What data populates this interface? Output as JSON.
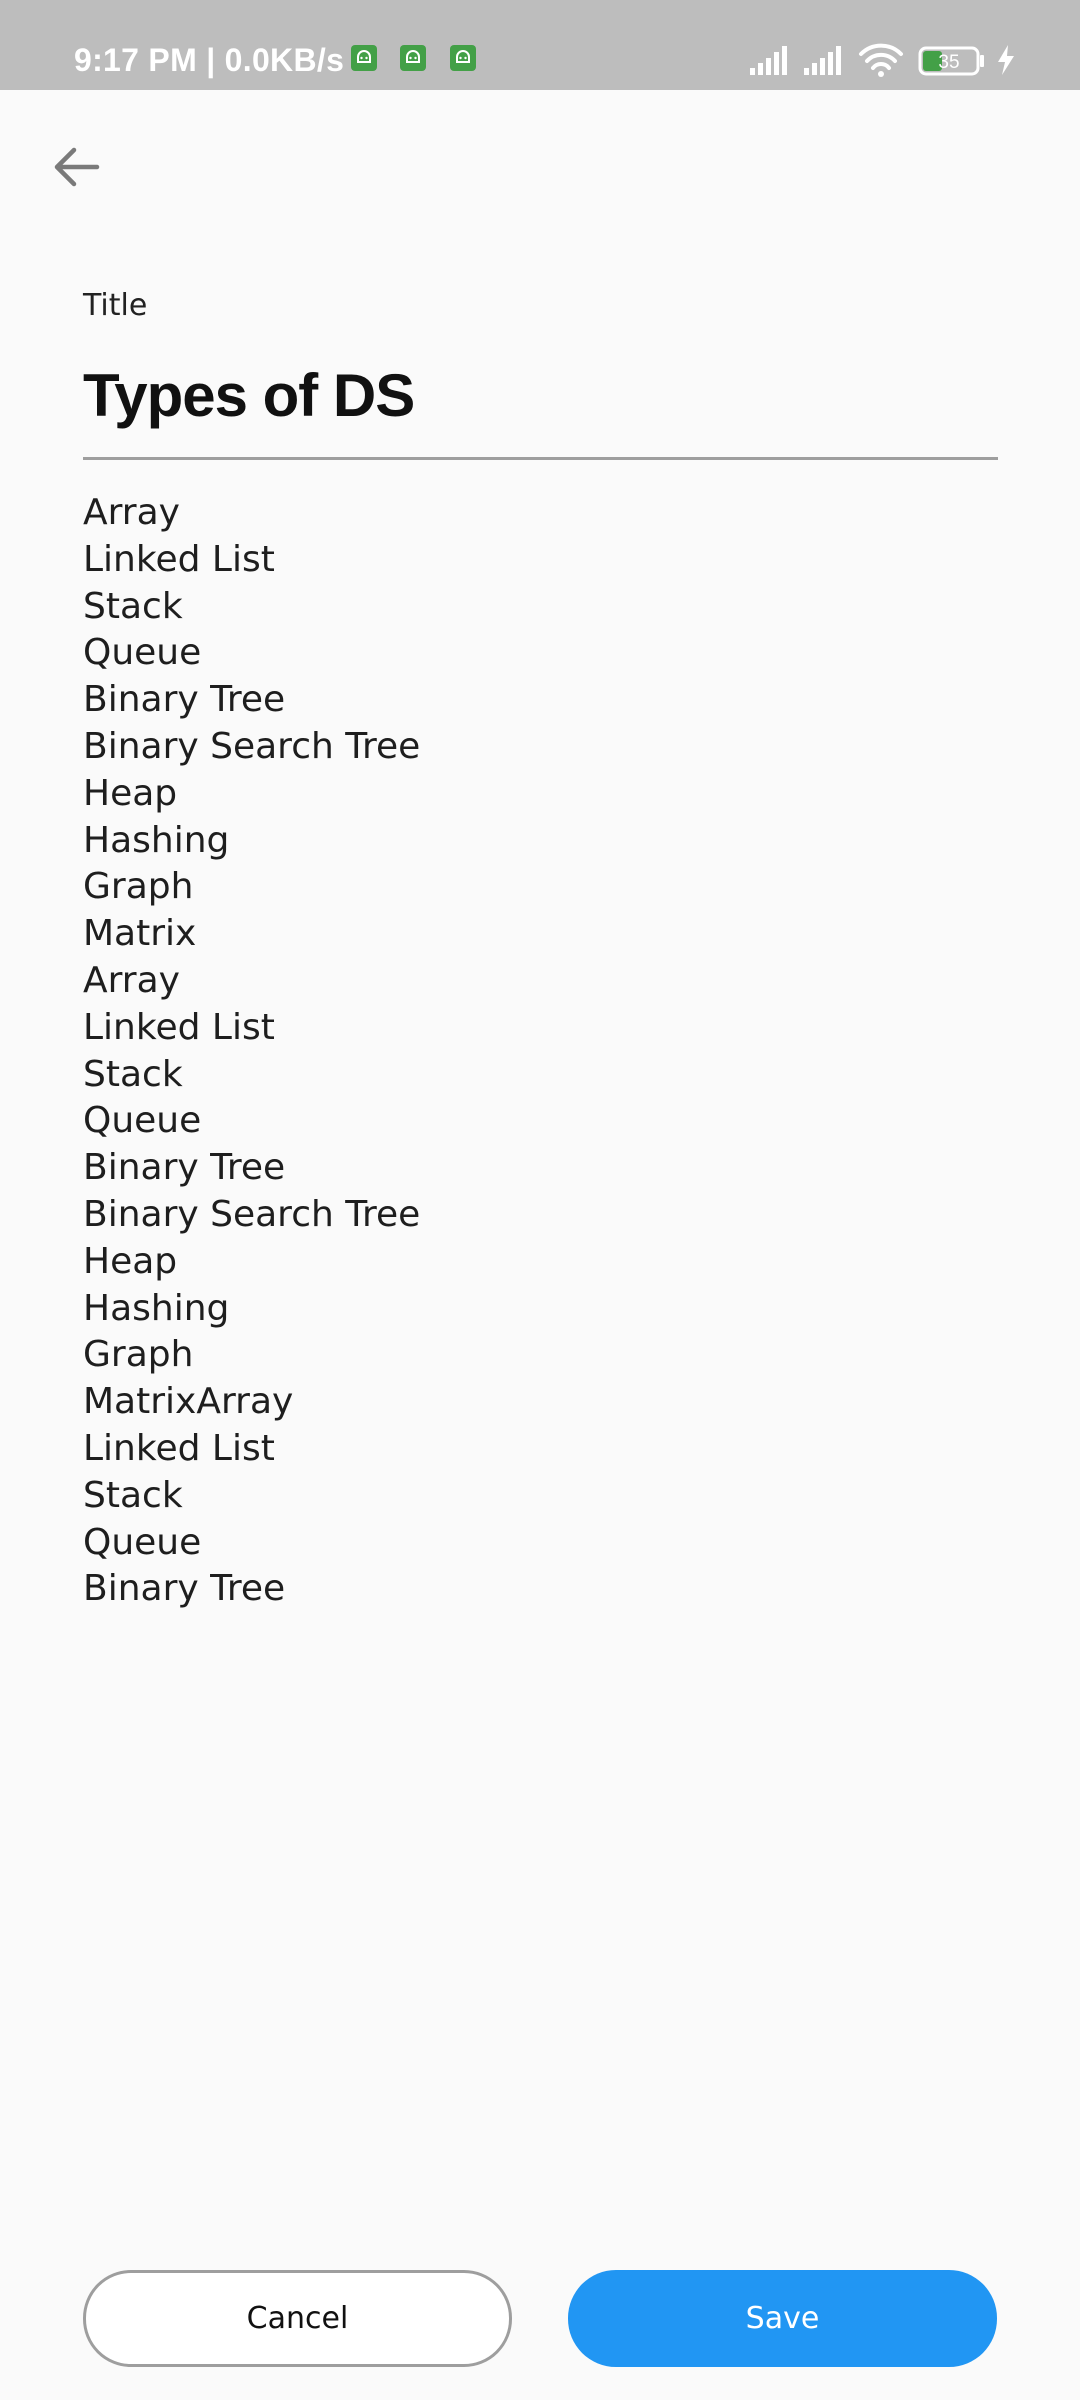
{
  "status_bar": {
    "time_text": "9:17 PM | 0.0KB/s",
    "battery_level": "35",
    "notification_icons": [
      "android-icon",
      "android-icon",
      "android-icon"
    ]
  },
  "header": {
    "back_icon": "arrow-left-icon"
  },
  "form": {
    "title_label": "Title",
    "title_value": "Types of DS",
    "body_lines": [
      "Array",
      "Linked List",
      "Stack",
      "Queue",
      "Binary Tree",
      "Binary Search Tree",
      "Heap",
      "Hashing",
      "Graph",
      "Matrix",
      "Array",
      "Linked List",
      "Stack",
      "Queue",
      "Binary Tree",
      "Binary Search Tree",
      "Heap",
      "Hashing",
      "Graph",
      "MatrixArray",
      "Linked List",
      "Stack",
      "Queue",
      "Binary Tree"
    ]
  },
  "actions": {
    "cancel_label": "Cancel",
    "save_label": "Save"
  },
  "colors": {
    "status_bar_bg": "#bdbdbd",
    "background": "#fafafa",
    "save_button": "#2196f3",
    "battery_fill": "#43a047"
  }
}
